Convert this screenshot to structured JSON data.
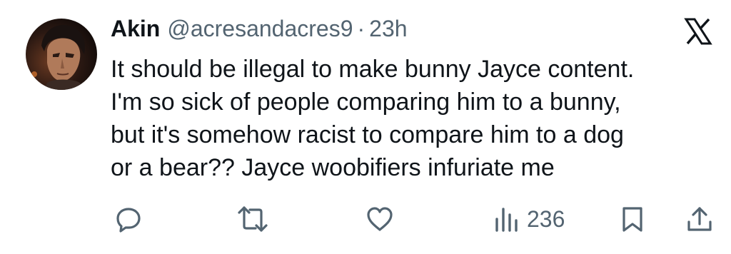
{
  "tweet": {
    "author_name": "Akin",
    "handle": "@acresandacres9",
    "separator": "·",
    "time": "23h",
    "text_lines": [
      "It should be illegal to make bunny Jayce content.",
      "I'm so sick of people comparing him to a bunny,",
      "but it's somehow racist to compare him to a dog",
      "or a bear?? Jayce woobifiers infuriate me"
    ],
    "views": "236"
  },
  "icons": {
    "brand": "x-logo-icon",
    "reply": "speech-bubble-icon",
    "repost": "repost-arrows-icon",
    "like": "heart-icon",
    "views": "bar-chart-icon",
    "bookmark": "bookmark-icon",
    "share": "share-upload-icon"
  },
  "colors": {
    "text_primary": "#0f1419",
    "text_secondary": "#536471",
    "background": "#ffffff"
  }
}
